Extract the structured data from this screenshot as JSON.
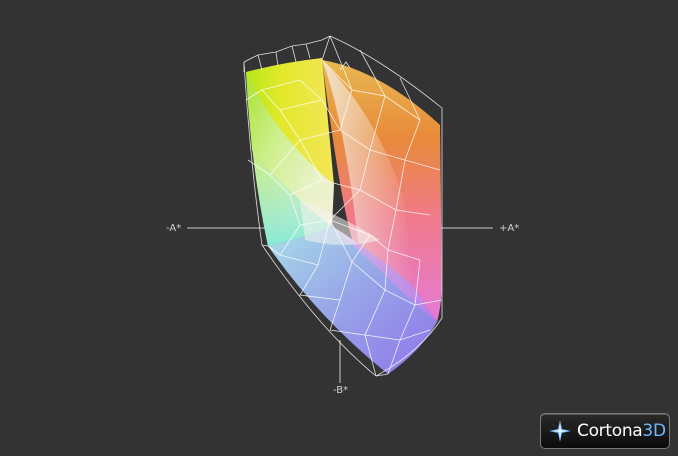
{
  "axes": {
    "neg_a": "-A*",
    "pos_a": "+A*",
    "neg_b": "-B*"
  },
  "logo": {
    "text_main": "Cortona",
    "text_accent": "3D"
  },
  "colors": {
    "background": "#333333",
    "axis_line": "#c8c8c8",
    "wireframe": "#ffffff",
    "logo_accent": "#6fb8ff"
  }
}
